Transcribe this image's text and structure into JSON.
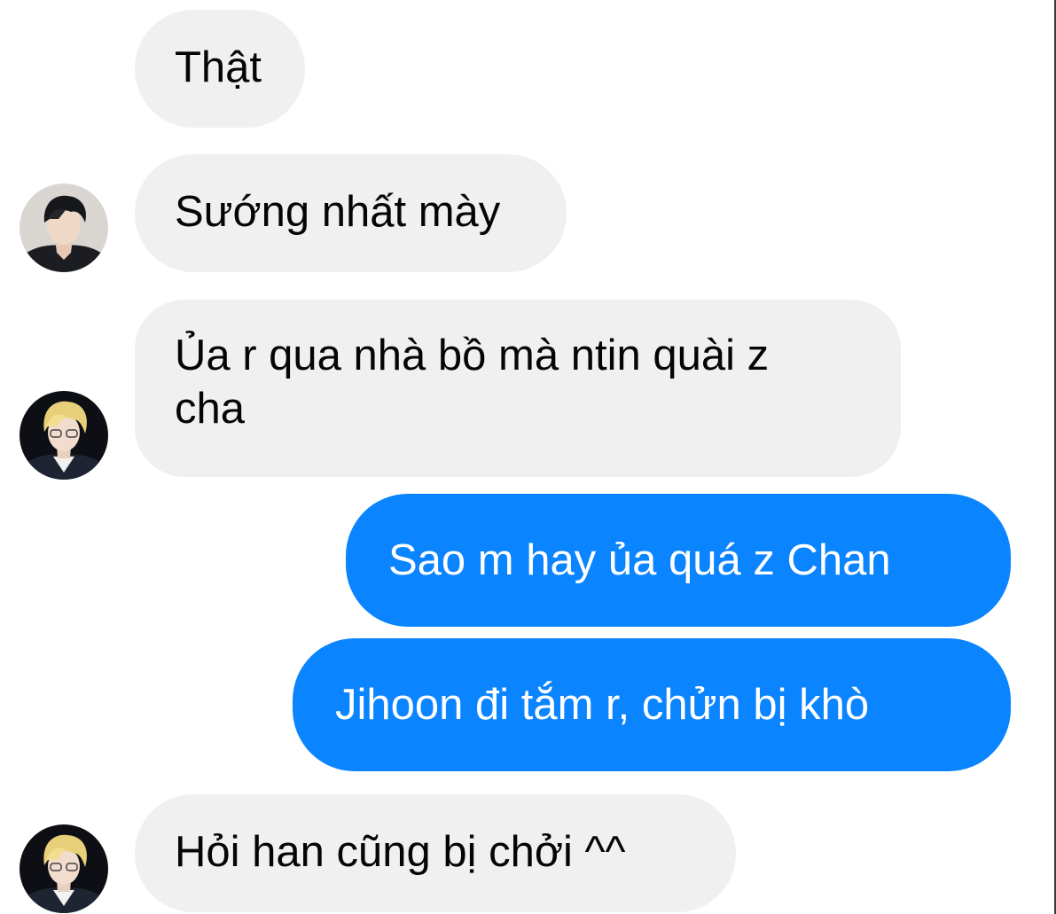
{
  "conversation": {
    "messages": [
      {
        "sender": "them",
        "text": "Thật"
      },
      {
        "sender": "them",
        "text": "Sướng nhất mày"
      },
      {
        "sender": "them",
        "text_line1": "Ủa r qua nhà bồ mà ntin quài z",
        "text_line2": "cha"
      },
      {
        "sender": "me",
        "text": "Sao m hay ủa quá z Chan"
      },
      {
        "sender": "me",
        "text": "Jihoon đi tắm r, chửn bị khò"
      },
      {
        "sender": "them",
        "text": "Hỏi han cũng bị chởi ^^"
      }
    ]
  },
  "colors": {
    "incoming_bubble": "#f0f0f0",
    "outgoing_bubble": "#0a84ff",
    "incoming_text": "#050505",
    "outgoing_text": "#ffffff"
  },
  "avatars": [
    {
      "icon": "dark-haired-person-avatar"
    },
    {
      "icon": "blonde-person-avatar"
    },
    {
      "icon": "blonde-person-avatar"
    }
  ]
}
